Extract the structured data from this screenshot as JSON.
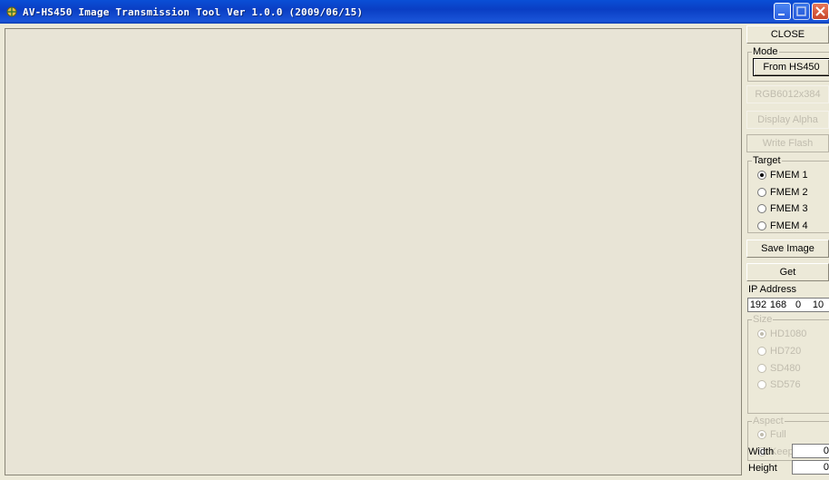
{
  "window": {
    "title": "AV-HS450 Image Transmission Tool Ver 1.0.0 (2009/06/15)",
    "icons": [
      "app-icon",
      "minimize-icon",
      "maximize-icon",
      "close-icon"
    ]
  },
  "panel": {
    "close_label": "CLOSE",
    "mode": {
      "label": "Mode",
      "button_label": "From HS450"
    },
    "rgb_label": "RGB6012x384",
    "display_alpha_label": "Display Alpha",
    "write_flash_label": "Write Flash",
    "target": {
      "label": "Target",
      "options": [
        "FMEM 1",
        "FMEM 2",
        "FMEM 3",
        "FMEM 4"
      ],
      "selected": "FMEM 1"
    },
    "save_image_label": "Save Image",
    "get_label": "Get",
    "ip": {
      "label": "IP Address",
      "segments": [
        "192",
        "168",
        "0",
        "10"
      ]
    },
    "size": {
      "label": "Size",
      "options": [
        "HD1080",
        "HD720",
        "SD480",
        "SD576"
      ],
      "selected": "HD1080"
    },
    "aspect": {
      "label": "Aspect",
      "options": [
        "Full",
        "Keep"
      ],
      "selected": "Full"
    },
    "width_label": "Width",
    "width_value": "0",
    "height_label": "Height",
    "height_value": "0"
  },
  "colors": {
    "titlebar": "#0a45cf",
    "window_bg": "#ece9d8",
    "disabled_text": "#c0bcae"
  }
}
